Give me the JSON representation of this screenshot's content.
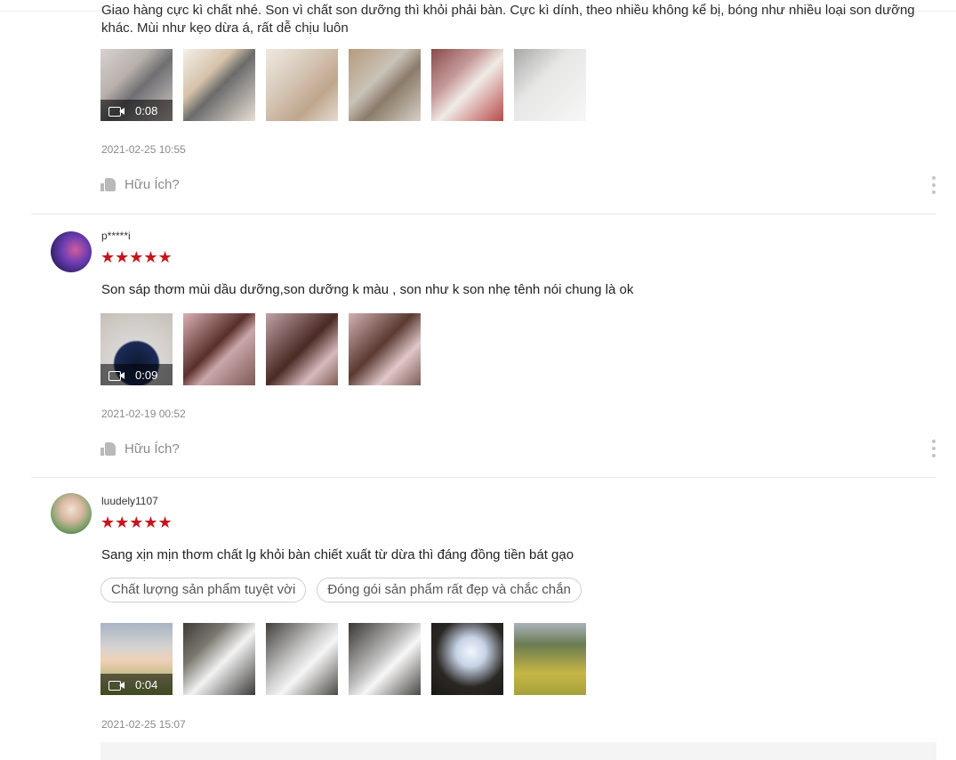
{
  "reviews": [
    {
      "comment": "Giao hàng cực kì chất nhé. Son vì chất son dưỡng thì khỏi phải bàn. Cực kì dính, theo nhiều không kể bị, bóng như nhiều loại son dưỡng khác. Mùi như kẹo dừa á, rất dễ chịu luôn",
      "video_duration": "0:08",
      "date": "2021-02-25 10:55",
      "helpful_label": "Hữu Ích?"
    },
    {
      "username": "p*****i",
      "stars": "★★★★★",
      "comment": "Son sáp thơm mùi dầu dưỡng,son dưỡng k màu , son như k son nhẹ tênh nói chung là ok",
      "video_duration": "0:09",
      "date": "2021-02-19 00:52",
      "helpful_label": "Hữu Ích?"
    },
    {
      "username": "luudely1107",
      "stars": "★★★★★",
      "comment": "Sang xịn mịn thơm chất lg khỏi bàn chiết xuất từ dừa thì đáng đồng tiền bát gạo",
      "tags": [
        "Chất lượng sản phẩm tuyệt vời",
        "Đóng gói sản phẩm rất đẹp và chắc chắn"
      ],
      "video_duration": "0:04",
      "date": "2021-02-25 15:07"
    }
  ],
  "colors": {
    "star": "#c4161c",
    "muted_text": "#8a8a8a",
    "divider": "#e6e6e6"
  },
  "icons": [
    "video-camera-icon",
    "thumbs-up-icon",
    "more-options-icon",
    "star-icon"
  ]
}
